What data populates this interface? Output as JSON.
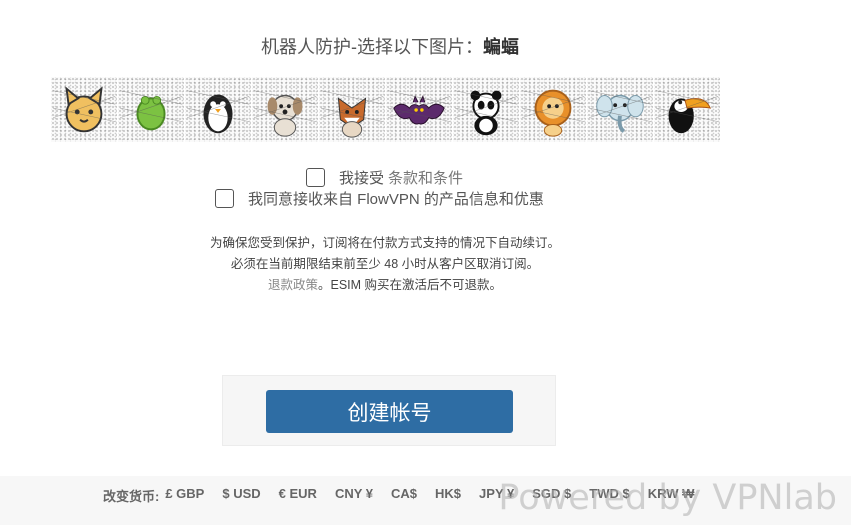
{
  "captcha": {
    "prompt": "机器人防护-选择以下图片：",
    "target": "蝙蝠",
    "images": [
      {
        "animal": "cat",
        "icon": "cat-icon",
        "color": "#f0c060"
      },
      {
        "animal": "frog",
        "icon": "frog-icon",
        "color": "#7cc242"
      },
      {
        "animal": "penguin",
        "icon": "penguin-icon",
        "color": "#222222"
      },
      {
        "animal": "dog",
        "icon": "dog-icon",
        "color": "#d8cfc2"
      },
      {
        "animal": "fox",
        "icon": "fox-icon",
        "color": "#c86a2c"
      },
      {
        "animal": "bat",
        "icon": "bat-icon",
        "color": "#5c2a6c"
      },
      {
        "animal": "panda",
        "icon": "panda-icon",
        "color": "#111111"
      },
      {
        "animal": "lion",
        "icon": "lion-icon",
        "color": "#e8902a"
      },
      {
        "animal": "elephant",
        "icon": "elephant-icon",
        "color": "#a8ccdc"
      },
      {
        "animal": "toucan",
        "icon": "toucan-icon",
        "color": "#f0a020"
      }
    ]
  },
  "agreements": {
    "terms_prefix": "我接受",
    "terms_link": "条款和条件",
    "marketing": "我同意接收来自 FlowVPN 的产品信息和优惠"
  },
  "notice": {
    "line1": "为确保您受到保护，订阅将在付款方式支持的情况下自动续订。",
    "line2": "必须在当前期限结束前至少 48 小时从客户区取消订阅。",
    "refund_link": "退款政策",
    "line3_rest": "。ESIM 购买在激活后不可退款。"
  },
  "actions": {
    "create_account": "创建帐号"
  },
  "footer": {
    "currency_label": "改变货币:",
    "currencies": [
      "£ GBP",
      "$ USD",
      "€ EUR",
      "CNY ¥",
      "CA$",
      "HK$",
      "JPY ¥",
      "SGD $",
      "TWD $",
      "KRW ₩"
    ],
    "powered_by": "Powered by VPNlab"
  },
  "colors": {
    "button": "#2e6da4",
    "footer_bg": "#f7f7f7"
  }
}
